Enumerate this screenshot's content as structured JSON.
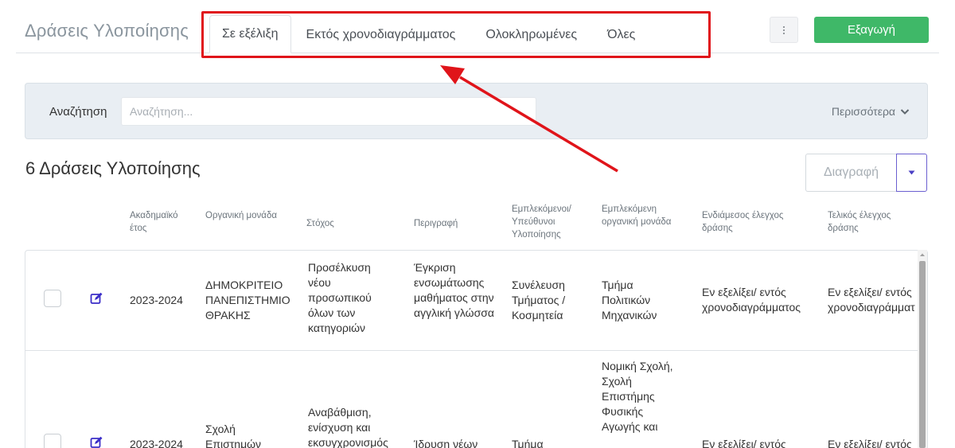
{
  "header": {
    "title": "Δράσεις Υλοποίησης",
    "tabs": [
      {
        "label": "Σε εξέλιξη",
        "active": true
      },
      {
        "label": "Εκτός χρονοδιαγράμματος",
        "active": false
      },
      {
        "label": "Ολοκληρωμένες",
        "active": false
      },
      {
        "label": "Όλες",
        "active": false
      }
    ],
    "kebab_icon": "more-vertical-icon",
    "export_label": "Εξαγωγή"
  },
  "search": {
    "label": "Αναζήτηση",
    "placeholder": "Αναζήτηση...",
    "more_label": "Περισσότερα"
  },
  "list": {
    "count_title": "6 Δράσεις Υλοποίησης",
    "delete_label": "Διαγραφή"
  },
  "table": {
    "columns": [
      "Ακαδημαϊκό έτος",
      "Οργανική μονάδα",
      "Στόχος",
      "Περιγραφή",
      "Εμπλεκόμενοι/ Υπεύθυνοι Υλοποίησης",
      "Εμπλεκόμενη οργανική μονάδα",
      "Ενδιάμεσος έλεγχος δράσης",
      "Τελικός έλεγχος δράσης"
    ],
    "rows": [
      {
        "year": "2023-2024",
        "unit": "ΔΗΜΟΚΡΙΤΕΙΟ ΠΑΝΕΠΙΣΤΗΜΙΟ ΘΡΑΚΗΣ",
        "goal": "Προσέλκυση νέου προσωπικού όλων των κατηγοριών",
        "description": "Έγκριση ενσωμάτωσης μαθήματος στην αγγλική γλώσσα",
        "responsible": "Συνέλευση Τμήματος / Κοσμητεία",
        "involved_unit": "Τμήμα Πολιτικών Μηχανικών",
        "interim_check": "Εν εξελίξει/ εντός χρονοδιαγράμματος",
        "final_check": "Εν εξελίξει/ εντός χρονοδιαγράμματος"
      },
      {
        "year": "2023-2024",
        "unit": "Σχολή Επιστημών",
        "goal": "Αναβάθμιση, ενίσχυση και εκσυγχρονισμός",
        "description": "Ίδρυση νέων",
        "responsible": "Τμήμα",
        "involved_unit": "Νομική Σχολή, Σχολή Επιστήμης Φυσικής Αγωγής και",
        "interim_check": "Εν εξελίξει/ εντός",
        "final_check": "Εν εξελίξει/ εντός"
      }
    ]
  },
  "colors": {
    "accent_green": "#3fb868",
    "highlight_red": "#e0141a",
    "edit_icon": "#3b2ec8",
    "caret_purple": "#6b5fd0"
  }
}
